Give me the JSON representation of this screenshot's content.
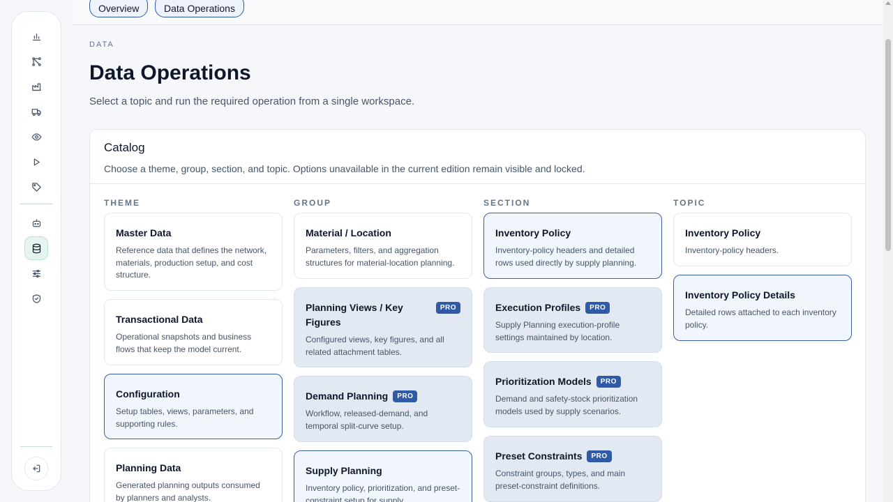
{
  "tabs": [
    {
      "label": "Overview"
    },
    {
      "label": "Data Operations"
    }
  ],
  "sidebar": {
    "icons": [
      "bar-chart-icon",
      "network-icon",
      "factory-icon",
      "truck-icon",
      "eye-icon",
      "play-icon",
      "tag-icon",
      "robot-icon",
      "database-icon",
      "sliders-icon",
      "shield-icon"
    ],
    "active": "database-icon",
    "logout_icon": "logout-icon"
  },
  "header": {
    "eyebrow": "DATA",
    "title": "Data Operations",
    "subtitle": "Select a topic and run the required operation from a single workspace."
  },
  "catalog": {
    "title": "Catalog",
    "description": "Choose a theme, group, section, and topic. Options unavailable in the current edition remain visible and locked.",
    "columns": {
      "theme": {
        "label": "THEME",
        "items": [
          {
            "title": "Master Data",
            "desc": "Reference data that defines the network, materials, production setup, and cost structure."
          },
          {
            "title": "Transactional Data",
            "desc": "Operational snapshots and business flows that keep the model current."
          },
          {
            "title": "Configuration",
            "desc": "Setup tables, views, parameters, and supporting rules."
          },
          {
            "title": "Planning Data",
            "desc": "Generated planning outputs consumed by planners and analysts."
          }
        ]
      },
      "group": {
        "label": "GROUP",
        "items": [
          {
            "title": "Material / Location",
            "desc": "Parameters, filters, and aggregation structures for material-location planning."
          },
          {
            "title": "Planning Views / Key Figures",
            "badge": "PRO",
            "desc": "Configured views, key figures, and all related attachment tables."
          },
          {
            "title": "Demand Planning",
            "badge": "PRO",
            "desc": "Workflow, released-demand, and temporal split-curve setup."
          },
          {
            "title": "Supply Planning",
            "desc": "Inventory policy, prioritization, and preset-constraint setup for supply"
          }
        ]
      },
      "section": {
        "label": "SECTION",
        "items": [
          {
            "title": "Inventory Policy",
            "desc": "Inventory-policy headers and detailed rows used directly by supply planning."
          },
          {
            "title": "Execution Profiles",
            "badge": "PRO",
            "desc": "Supply Planning execution-profile settings maintained by location."
          },
          {
            "title": "Prioritization Models",
            "badge": "PRO",
            "desc": "Demand and safety-stock prioritization models used by supply scenarios."
          },
          {
            "title": "Preset Constraints",
            "badge": "PRO",
            "desc": "Constraint groups, types, and main preset-constraint definitions."
          }
        ]
      },
      "topic": {
        "label": "TOPIC",
        "items": [
          {
            "title": "Inventory Policy",
            "desc": "Inventory-policy headers."
          },
          {
            "title": "Inventory Policy Details",
            "desc": "Detailed rows attached to each inventory policy."
          }
        ]
      }
    }
  }
}
